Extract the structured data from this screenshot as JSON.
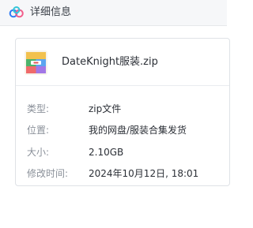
{
  "header": {
    "title": "详细信息",
    "logo_icon": "cloud-logo-icon"
  },
  "file": {
    "name": "DateKnight服装.zip",
    "icon": "zip-archive-icon"
  },
  "details": [
    {
      "label": "类型:",
      "value": "zip文件"
    },
    {
      "label": "位置:",
      "value": "我的网盘/服装合集发货"
    },
    {
      "label": "大小:",
      "value": "2.10GB"
    },
    {
      "label": "修改时间:",
      "value": "2024年10月12日, 18:01"
    }
  ],
  "colors": {
    "header_bg": "#f6f7f9",
    "label": "#8a9099",
    "value": "#2b2f36",
    "logo_blue": "#2f7bf5",
    "logo_pink": "#f25c8a"
  }
}
